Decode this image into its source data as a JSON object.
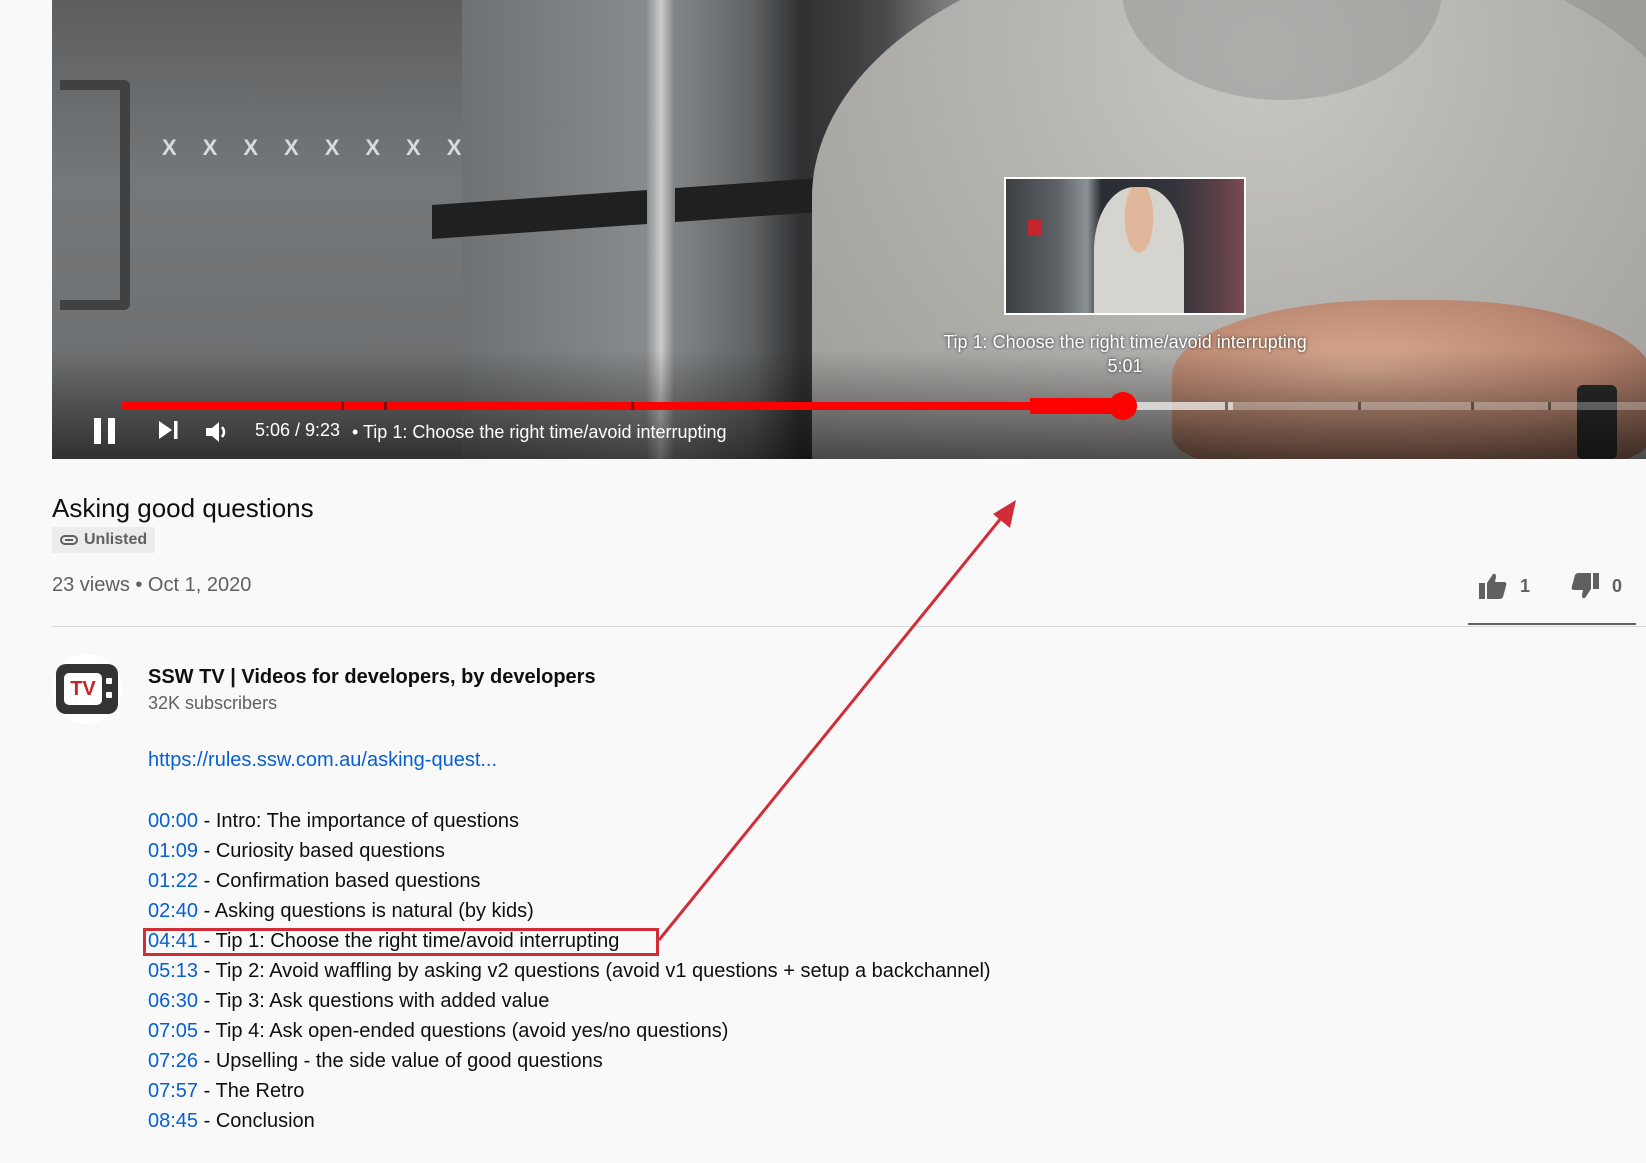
{
  "player": {
    "preview_chapter": "Tip 1: Choose the right time/avoid interrupting",
    "preview_time": "5:01",
    "time_display": "5:06 / 9:23",
    "chapter_label": "• Tip 1: Choose the right time/avoid interrupting",
    "progress": {
      "played_fraction": 0.576,
      "hover_end_fraction": 0.635,
      "loaded_fraction": 0.705,
      "chapter_marks": [
        0.139,
        0.166,
        0.323,
        0.7,
        0.784,
        0.856,
        0.905
      ]
    }
  },
  "video": {
    "title": "Asking good questions",
    "visibility": "Unlisted",
    "views_date": "23 views • Oct 1, 2020",
    "likes": "1",
    "dislikes": "0"
  },
  "channel": {
    "logo_text": "TV",
    "name": "SSW TV | Videos for developers, by developers",
    "subscribers": "32K subscribers"
  },
  "description": {
    "link": "https://rules.ssw.com.au/asking-quest...",
    "chapters": [
      {
        "time": "00:00",
        "title": " - Intro: The importance of questions"
      },
      {
        "time": "01:09",
        "title": " - Curiosity based questions"
      },
      {
        "time": "01:22",
        "title": " - Confirmation based questions"
      },
      {
        "time": "02:40",
        "title": " - Asking questions is natural (by kids)"
      },
      {
        "time": "04:41",
        "title": " - Tip 1: Choose the right time/avoid interrupting"
      },
      {
        "time": "05:13",
        "title": " - Tip 2: Avoid waffling by asking v2 questions (avoid v1 questions + setup a backchannel)"
      },
      {
        "time": "06:30",
        "title": " - Tip 3: Ask questions with added value"
      },
      {
        "time": "07:05",
        "title": " - Tip 4: Ask open-ended questions (avoid yes/no questions)"
      },
      {
        "time": "07:26",
        "title": " - Upselling - the side value of good questions"
      },
      {
        "time": "07:57",
        "title": " - The Retro"
      },
      {
        "time": "08:45",
        "title": " - Conclusion"
      }
    ]
  },
  "colors": {
    "progress_red": "#ff0000",
    "link_blue": "#065fd4",
    "annotation_red": "#d12d39"
  },
  "icons": [
    "pause-icon",
    "next-icon",
    "volume-icon",
    "link-icon",
    "thumbs-up-icon",
    "thumbs-down-icon"
  ]
}
